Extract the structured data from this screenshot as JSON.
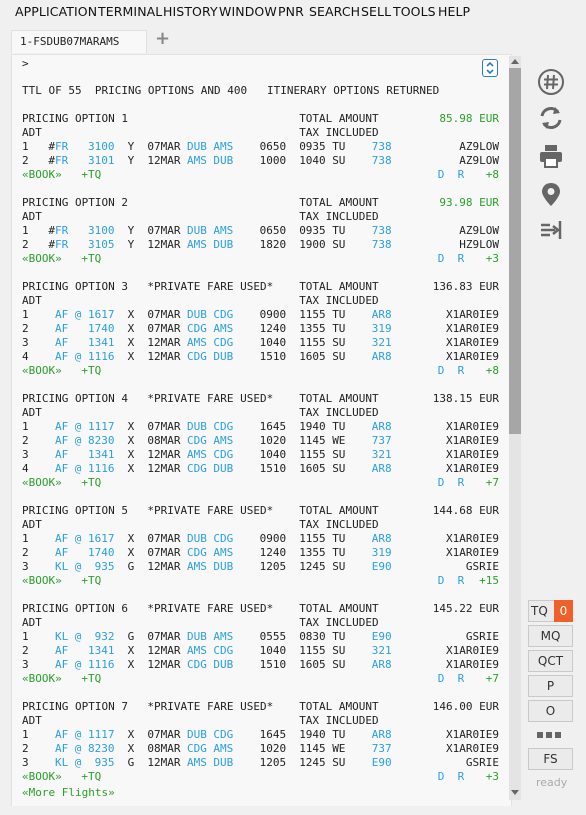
{
  "menu": [
    "APPLICATION",
    "TERMINAL",
    "HISTORY",
    "WINDOW",
    "PNR",
    "SEARCH",
    "SELL",
    "TOOLS",
    "HELP"
  ],
  "tab": {
    "title": "1-FSDUB07MARAMS",
    "add_symbol": "+"
  },
  "terminal": {
    "prompt": ">",
    "ttl": "TTL OF 55  PRICING OPTIONS AND 400   ITINERARY OPTIONS RETURNED",
    "total_label": "TOTAL AMOUNT",
    "tax_label": "TAX INCLUDED",
    "pax": "ADT",
    "book_label": "«BOOK»",
    "tq_label": "+TQ",
    "d": "D",
    "r": "R",
    "more_flights": "«More Flights»",
    "options": [
      {
        "title": "PRICING OPTION 1",
        "private": "",
        "amount": "85.98 EUR",
        "amount_green": true,
        "more": "+8",
        "segments": [
          {
            "n": "1",
            "mark": "#",
            "al": "FR",
            "fl": "3100",
            "cls": "Y",
            "date": "07MAR",
            "from": "DUB",
            "to": "AMS",
            "dep": "0650",
            "arr": "0935",
            "day": "TU",
            "eq": "738",
            "fare": "AZ9LOW"
          },
          {
            "n": "2",
            "mark": "#",
            "al": "FR",
            "fl": "3101",
            "cls": "Y",
            "date": "12MAR",
            "from": "AMS",
            "to": "DUB",
            "dep": "1000",
            "arr": "1040",
            "day": "SU",
            "eq": "738",
            "fare": "AZ9LOW"
          }
        ]
      },
      {
        "title": "PRICING OPTION 2",
        "private": "",
        "amount": "93.98 EUR",
        "amount_green": true,
        "more": "+3",
        "segments": [
          {
            "n": "1",
            "mark": "#",
            "al": "FR",
            "fl": "3100",
            "cls": "Y",
            "date": "07MAR",
            "from": "DUB",
            "to": "AMS",
            "dep": "0650",
            "arr": "0935",
            "day": "TU",
            "eq": "738",
            "fare": "AZ9LOW"
          },
          {
            "n": "2",
            "mark": "#",
            "al": "FR",
            "fl": "3105",
            "cls": "Y",
            "date": "12MAR",
            "from": "AMS",
            "to": "DUB",
            "dep": "1820",
            "arr": "1900",
            "day": "SU",
            "eq": "738",
            "fare": "HZ9LOW"
          }
        ]
      },
      {
        "title": "PRICING OPTION 3",
        "private": "*PRIVATE FARE USED*",
        "amount": "136.83 EUR",
        "amount_green": false,
        "more": "+8",
        "segments": [
          {
            "n": "1",
            "mark": "",
            "al": "AF",
            "at": "@",
            "fl": "1617",
            "cls": "X",
            "date": "07MAR",
            "from": "DUB",
            "to": "CDG",
            "dep": "0900",
            "arr": "1155",
            "day": "TU",
            "eq": "AR8",
            "fare": "X1AR0IE9"
          },
          {
            "n": "2",
            "mark": "",
            "al": "AF",
            "at": "",
            "fl": "1740",
            "cls": "X",
            "date": "07MAR",
            "from": "CDG",
            "to": "AMS",
            "dep": "1240",
            "arr": "1355",
            "day": "TU",
            "eq": "319",
            "fare": "X1AR0IE9"
          },
          {
            "n": "3",
            "mark": "",
            "al": "AF",
            "at": "",
            "fl": "1341",
            "cls": "X",
            "date": "12MAR",
            "from": "AMS",
            "to": "CDG",
            "dep": "1040",
            "arr": "1155",
            "day": "SU",
            "eq": "321",
            "fare": "X1AR0IE9"
          },
          {
            "n": "4",
            "mark": "",
            "al": "AF",
            "at": "@",
            "fl": "1116",
            "cls": "X",
            "date": "12MAR",
            "from": "CDG",
            "to": "DUB",
            "dep": "1510",
            "arr": "1605",
            "day": "SU",
            "eq": "AR8",
            "fare": "X1AR0IE9"
          }
        ]
      },
      {
        "title": "PRICING OPTION 4",
        "private": "*PRIVATE FARE USED*",
        "amount": "138.15 EUR",
        "amount_green": false,
        "more": "+7",
        "segments": [
          {
            "n": "1",
            "mark": "",
            "al": "AF",
            "at": "@",
            "fl": "1117",
            "cls": "X",
            "date": "07MAR",
            "from": "DUB",
            "to": "CDG",
            "dep": "1645",
            "arr": "1940",
            "day": "TU",
            "eq": "AR8",
            "fare": "X1AR0IE9"
          },
          {
            "n": "2",
            "mark": "",
            "al": "AF",
            "at": "@",
            "fl": "8230",
            "cls": "X",
            "date": "08MAR",
            "from": "CDG",
            "to": "AMS",
            "dep": "1020",
            "arr": "1145",
            "day": "WE",
            "eq": "737",
            "fare": "X1AR0IE9"
          },
          {
            "n": "3",
            "mark": "",
            "al": "AF",
            "at": "",
            "fl": "1341",
            "cls": "X",
            "date": "12MAR",
            "from": "AMS",
            "to": "CDG",
            "dep": "1040",
            "arr": "1155",
            "day": "SU",
            "eq": "321",
            "fare": "X1AR0IE9"
          },
          {
            "n": "4",
            "mark": "",
            "al": "AF",
            "at": "@",
            "fl": "1116",
            "cls": "X",
            "date": "12MAR",
            "from": "CDG",
            "to": "DUB",
            "dep": "1510",
            "arr": "1605",
            "day": "SU",
            "eq": "AR8",
            "fare": "X1AR0IE9"
          }
        ]
      },
      {
        "title": "PRICING OPTION 5",
        "private": "*PRIVATE FARE USED*",
        "amount": "144.68 EUR",
        "amount_green": false,
        "more": "+15",
        "segments": [
          {
            "n": "1",
            "mark": "",
            "al": "AF",
            "at": "@",
            "fl": "1617",
            "cls": "X",
            "date": "07MAR",
            "from": "DUB",
            "to": "CDG",
            "dep": "0900",
            "arr": "1155",
            "day": "TU",
            "eq": "AR8",
            "fare": "X1AR0IE9"
          },
          {
            "n": "2",
            "mark": "",
            "al": "AF",
            "at": "",
            "fl": "1740",
            "cls": "X",
            "date": "07MAR",
            "from": "CDG",
            "to": "AMS",
            "dep": "1240",
            "arr": "1355",
            "day": "TU",
            "eq": "319",
            "fare": "X1AR0IE9"
          },
          {
            "n": "3",
            "mark": "",
            "al": "KL",
            "at": "@",
            "fl": "935",
            "cls": "G",
            "date": "12MAR",
            "from": "AMS",
            "to": "DUB",
            "dep": "1205",
            "arr": "1245",
            "day": "SU",
            "eq": "E90",
            "fare": "GSRIE"
          }
        ]
      },
      {
        "title": "PRICING OPTION 6",
        "private": "*PRIVATE FARE USED*",
        "amount": "145.22 EUR",
        "amount_green": false,
        "more": "+7",
        "segments": [
          {
            "n": "1",
            "mark": "",
            "al": "KL",
            "at": "@",
            "fl": "932",
            "cls": "G",
            "date": "07MAR",
            "from": "DUB",
            "to": "AMS",
            "dep": "0555",
            "arr": "0830",
            "day": "TU",
            "eq": "E90",
            "fare": "GSRIE"
          },
          {
            "n": "2",
            "mark": "",
            "al": "AF",
            "at": "",
            "fl": "1341",
            "cls": "X",
            "date": "12MAR",
            "from": "AMS",
            "to": "CDG",
            "dep": "1040",
            "arr": "1155",
            "day": "SU",
            "eq": "321",
            "fare": "X1AR0IE9"
          },
          {
            "n": "3",
            "mark": "",
            "al": "AF",
            "at": "@",
            "fl": "1116",
            "cls": "X",
            "date": "12MAR",
            "from": "CDG",
            "to": "DUB",
            "dep": "1510",
            "arr": "1605",
            "day": "SU",
            "eq": "AR8",
            "fare": "X1AR0IE9"
          }
        ]
      },
      {
        "title": "PRICING OPTION 7",
        "private": "*PRIVATE FARE USED*",
        "amount": "146.00 EUR",
        "amount_green": false,
        "more": "+3",
        "segments": [
          {
            "n": "1",
            "mark": "",
            "al": "AF",
            "at": "@",
            "fl": "1117",
            "cls": "X",
            "date": "07MAR",
            "from": "DUB",
            "to": "CDG",
            "dep": "1645",
            "arr": "1940",
            "day": "TU",
            "eq": "AR8",
            "fare": "X1AR0IE9"
          },
          {
            "n": "2",
            "mark": "",
            "al": "AF",
            "at": "@",
            "fl": "8230",
            "cls": "X",
            "date": "08MAR",
            "from": "CDG",
            "to": "AMS",
            "dep": "1020",
            "arr": "1145",
            "day": "WE",
            "eq": "737",
            "fare": "X1AR0IE9"
          },
          {
            "n": "3",
            "mark": "",
            "al": "KL",
            "at": "@",
            "fl": "935",
            "cls": "G",
            "date": "12MAR",
            "from": "AMS",
            "to": "DUB",
            "dep": "1205",
            "arr": "1245",
            "day": "SU",
            "eq": "E90",
            "fare": "GSRIE"
          }
        ]
      }
    ]
  },
  "side_buttons": {
    "tq": "TQ",
    "tq_count": "0",
    "mq": "MQ",
    "qct": "QCT",
    "p": "P",
    "o": "O",
    "fs": "FS",
    "status": "ready"
  },
  "icons": [
    "hash-icon",
    "refresh-icon",
    "print-icon",
    "location-pin-icon",
    "split-icon"
  ],
  "colors": {
    "link_blue": "#2aa0e0",
    "green": "#2aa02a",
    "tq_badge": "#f0602a"
  }
}
